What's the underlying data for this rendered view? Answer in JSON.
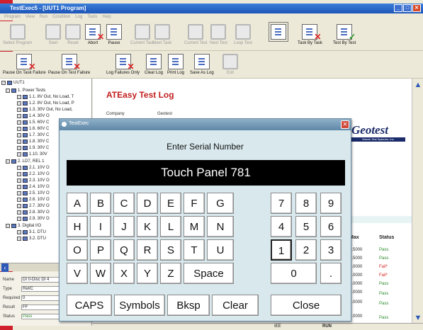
{
  "window": {
    "title": "TestExec5 - [UUT1 Program]",
    "min": "_",
    "max": "□",
    "close": "✕"
  },
  "menu": [
    "Program",
    "View",
    "Run",
    "Condition",
    "Log",
    "Tools",
    "Help"
  ],
  "toolbar1": [
    "Select Program",
    "Start",
    "Reset",
    "Abort",
    "Pause",
    "Current Task",
    "Next Task",
    "Current Test",
    "Next Test",
    "Loop Test",
    "",
    "Task By Task",
    "Test By Test"
  ],
  "toolbar2": [
    "Pause On Task Failure",
    "Pause On Test Failure",
    "Log Failures Only",
    "Clear Log",
    "Print Log",
    "Save As Log",
    "Exit"
  ],
  "tree": {
    "root": "UUT1",
    "items": [
      {
        "label": "1. Power Tests",
        "level": 1
      },
      {
        "label": "1.1. 8V Out, No Load, T",
        "level": 2
      },
      {
        "label": "1.2. 8V Out, No Load, P",
        "level": 2
      },
      {
        "label": "1.3. 30V Out, No Load,",
        "level": 2
      },
      {
        "label": "1.4. 30V O",
        "level": 2
      },
      {
        "label": "1.5. 60V C",
        "level": 2
      },
      {
        "label": "1.6. 60V C",
        "level": 2
      },
      {
        "label": "1.7. 30V C",
        "level": 2
      },
      {
        "label": "1.8. 30V C",
        "level": 2
      },
      {
        "label": "1.9. 30V C",
        "level": 2
      },
      {
        "label": "1.10. 30V",
        "level": 2
      },
      {
        "label": "2. LD7, REL 1",
        "level": 1
      },
      {
        "label": "2.1. 10V O",
        "level": 2
      },
      {
        "label": "2.2. 10V O",
        "level": 2
      },
      {
        "label": "2.3. 10V O",
        "level": 2
      },
      {
        "label": "2.4. 10V O",
        "level": 2
      },
      {
        "label": "2.5. 10V O",
        "level": 2
      },
      {
        "label": "2.6. 10V O",
        "level": 2
      },
      {
        "label": "2.7. 30V O",
        "level": 2
      },
      {
        "label": "2.8. 30V O",
        "level": 2
      },
      {
        "label": "2.9. 30V O",
        "level": 2
      },
      {
        "label": "3. Digital I/O",
        "level": 1
      },
      {
        "label": "3.1. DTU",
        "level": 2
      },
      {
        "label": "3.2. DTU",
        "level": 2
      }
    ]
  },
  "props": [
    {
      "k": "Name",
      "v": "DI 0-Disc DI 4"
    },
    {
      "k": "Type",
      "v": "Rel/C"
    },
    {
      "k": "Required",
      "v": "0"
    },
    {
      "k": "Result",
      "v": "FF"
    },
    {
      "k": "Status",
      "v": "Pass"
    }
  ],
  "log": {
    "title": "ATEasy Test Log",
    "company_label": "Company",
    "company": "Geotest"
  },
  "logo": {
    "name": "Geotest",
    "sub": "Marvin Test Systems, Inc."
  },
  "results": {
    "headers": [
      "Max",
      "Status"
    ],
    "rows": [
      [
        "0.5000",
        "Pass"
      ],
      [
        "0.5000",
        "Pass"
      ],
      [
        "0.0000",
        "Fail*"
      ],
      [
        "0.0000",
        "Fail*"
      ],
      [
        "0.0000",
        "Pass"
      ],
      [
        "0.0000",
        "Pass"
      ],
      [
        "0.0000",
        "Pass"
      ],
      [
        "0.0000",
        "Pass"
      ]
    ]
  },
  "statusbar": {
    "left": "IEE",
    "right": "RUN"
  },
  "dialog": {
    "title": "TestExec",
    "prompt": "Enter Serial Number",
    "serial": "Touch Panel 781",
    "row1": [
      "A",
      "B",
      "C",
      "D",
      "E",
      "F",
      "G"
    ],
    "row2": [
      "H",
      "I",
      "J",
      "K",
      "L",
      "M",
      "N"
    ],
    "row3": [
      "O",
      "P",
      "Q",
      "R",
      "S",
      "T",
      "U"
    ],
    "row4": [
      "V",
      "W",
      "X",
      "Y",
      "Z",
      "Space"
    ],
    "num": [
      "7",
      "8",
      "9",
      "4",
      "5",
      "6",
      "1",
      "2",
      "3",
      "0",
      "."
    ],
    "bottom": [
      "CAPS",
      "Symbols",
      "Bksp",
      "Clear",
      "Close"
    ]
  }
}
